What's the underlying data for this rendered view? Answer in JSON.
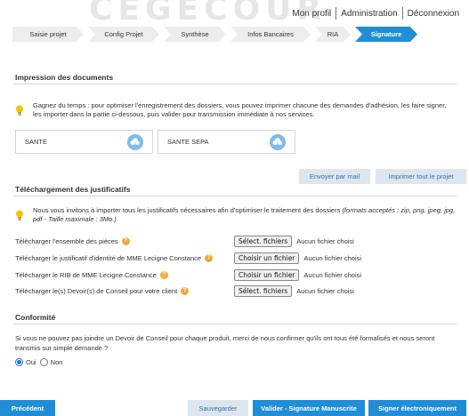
{
  "header": {
    "logo": "CEGECOUR",
    "nav": [
      "Mon profil",
      "Administration",
      "Déconnexion"
    ]
  },
  "steps": [
    {
      "label": "Saisie projet",
      "active": false
    },
    {
      "label": "Config Projet",
      "active": false
    },
    {
      "label": "Synthèse",
      "active": false
    },
    {
      "label": "Infos Bancaires",
      "active": false
    },
    {
      "label": "RIA",
      "active": false
    },
    {
      "label": "Signature",
      "active": true
    }
  ],
  "impression": {
    "title": "Impression des documents",
    "info": "Gagnez du temps : pour optimiser l'enregistrement des dossiers, vous pouvez imprimer chacune des demandes d'adhésion, les faire signer, les importer dans la partie ci-dessous, puis valider pour transmission immédiate à nos services.",
    "cards": [
      "SANTE",
      "SANTE SEPA"
    ],
    "send_mail": "Envoyer par mail",
    "print_all": "Imprimer tout le projet"
  },
  "telechargement": {
    "title": "Téléchargement des justificatifs",
    "info": "Nous vous invitons à importer tous les justificatifs nécessaires afin d'optimiser le traitement des dossiers",
    "info_formats": "(formats acceptés : zip, png, jpeg, jpg, pdf - Taille maximale : 3Mo.)",
    "rows": [
      {
        "label": "Télécharger l'ensemble des pièces",
        "button": "Sélect. fichiers",
        "status": "Aucun fichier choisi"
      },
      {
        "label": "Télécharger le justificatif d'identité de MME Lecigne Constance",
        "button": "Choisir un fichier",
        "status": "Aucun fichier choisi"
      },
      {
        "label": "Télécharger le RIB de MME Lecigne Constance",
        "button": "Choisir un fichier",
        "status": "Aucun fichier choisi"
      },
      {
        "label": "Télécharger le(s) Devoir(s) de Conseil pour votre client",
        "button": "Sélect. fichiers",
        "status": "Aucun fichier choisi"
      }
    ],
    "help_icon": "?"
  },
  "conformite": {
    "title": "Conformité",
    "text": "Si vous ne pouvez pas joindre un Devoir de Conseil pour chaque produit, merci de nous confirmer qu'ils ont tous été formalisés et nous seront transmis sur simple demande ?",
    "options": [
      "Oui",
      "Non"
    ],
    "selected": "Oui"
  },
  "footer": {
    "previous": "Précédent",
    "save": "Sauvegarder",
    "validate": "Valider - Signature Manuscrite",
    "esign": "Signer électroniquement"
  },
  "colors": {
    "primary": "#1f8ed6",
    "light_button": "#dde6f0",
    "step_gray": "#ededed",
    "help": "#f2a93b",
    "bulb": "#f5c400"
  },
  "icons": {
    "bulb": "lightbulb-icon",
    "cloud": "cloud-icon",
    "help": "help-circle-icon"
  }
}
